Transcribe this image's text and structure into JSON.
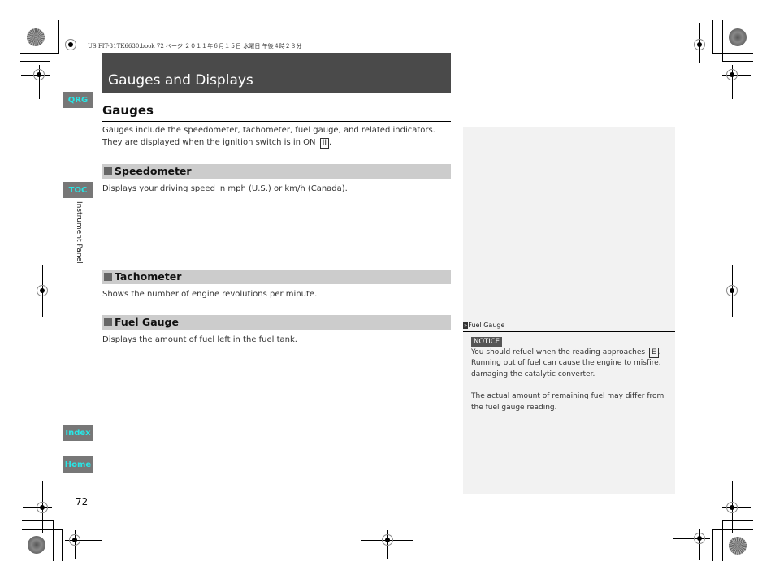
{
  "print_header": "US FIT-31TK6630.book  72 ページ  ２０１１年６月１５日  水曜日  午後４時２３分",
  "chapter_title": "Gauges and Displays",
  "side_nav": {
    "qrg": "QRG",
    "toc": "TOC",
    "section_label": "Instrument Panel",
    "index": "Index",
    "home": "Home"
  },
  "section": {
    "title": "Gauges",
    "intro_line1": "Gauges include the speedometer, tachometer, fuel gauge, and related indicators.",
    "intro_line2": "They are displayed when the ignition switch is in ON",
    "ignition_key": "II",
    "intro_end": "."
  },
  "subsections": [
    {
      "title": "Speedometer",
      "text": "Displays your driving speed in mph (U.S.) or km/h (Canada)."
    },
    {
      "title": "Tachometer",
      "text": "Shows the number of engine revolutions per minute."
    },
    {
      "title": "Fuel Gauge",
      "text": "Displays the amount of fuel left in the fuel tank."
    }
  ],
  "side_note": {
    "ref_icon": "»",
    "ref_title": "Fuel Gauge",
    "notice_label": "NOTICE",
    "line1": "You should refuel when the reading approaches",
    "empty_key": "E",
    "line1_end": ".",
    "line2": "Running out of fuel can cause the engine to misfire,",
    "line3": "damaging the catalytic converter.",
    "line4": "The actual amount of remaining fuel may differ from",
    "line5": "the fuel gauge reading."
  },
  "page_number": "72",
  "colors": {
    "title_bar": "#4a4a4a",
    "side_button_bg": "#777777",
    "side_button_text": "#28e6e6",
    "subsection_bar": "#cccccc",
    "side_panel": "#f2f2f2"
  }
}
